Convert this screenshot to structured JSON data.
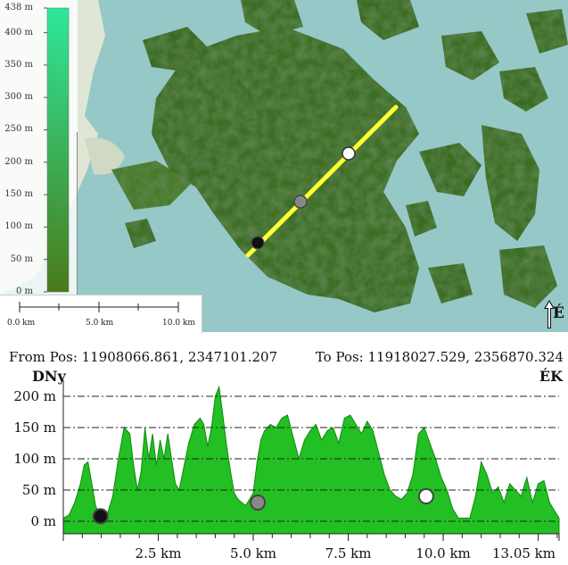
{
  "map": {
    "elevation_legend": {
      "labels": [
        "438 m",
        "400 m",
        "350 m",
        "300 m",
        "250 m",
        "200 m",
        "150 m",
        "100 m",
        "50 m",
        "0 m"
      ],
      "values": [
        438,
        400,
        350,
        300,
        250,
        200,
        150,
        100,
        50,
        0
      ],
      "max": 438,
      "colors": {
        "top": "#2ee89a",
        "bottom": "#4a7a1a"
      }
    },
    "scale_bar": {
      "labels": [
        "0.0 km",
        "5.0 km",
        "10.0 km"
      ]
    },
    "north_arrow": {
      "icon": "north-arrow-icon",
      "label": "É"
    },
    "colors": {
      "water": "#96c8c8",
      "terrain": "#3c6e28",
      "profile_line": "#ffff33"
    }
  },
  "profile": {
    "from_label": "From Pos: 11908066.861, 2347101.207",
    "to_label": "To Pos: 11918027.529, 2356870.324",
    "left_dir": "DNy",
    "right_dir": "ÉK",
    "colors": {
      "fill": "#22c022",
      "stroke": "#118811"
    },
    "chart_data": {
      "type": "area",
      "y_tick_labels": [
        "200 m",
        "150 m",
        "100 m",
        "50 m",
        "0 m"
      ],
      "y_ticks": [
        200,
        150,
        100,
        50,
        0
      ],
      "x_tick_labels": [
        "2.5 km",
        "5.0 km",
        "7.5 km",
        "10.0 km",
        "13.05 km"
      ],
      "x_ticks": [
        2.5,
        5.0,
        7.5,
        10.0,
        13.05
      ],
      "xlim": [
        0,
        13.05
      ],
      "ylim": [
        -20,
        220
      ],
      "grid": "horizontal dash-dot",
      "x": [
        0,
        0.15,
        0.3,
        0.45,
        0.55,
        0.65,
        0.75,
        0.85,
        0.95,
        1.05,
        1.15,
        1.3,
        1.45,
        1.6,
        1.75,
        1.85,
        1.95,
        2.05,
        2.15,
        2.25,
        2.35,
        2.45,
        2.55,
        2.65,
        2.75,
        2.85,
        2.95,
        3.05,
        3.15,
        3.3,
        3.45,
        3.6,
        3.7,
        3.8,
        3.9,
        4.0,
        4.1,
        4.2,
        4.3,
        4.4,
        4.5,
        4.6,
        4.7,
        4.8,
        4.9,
        5.0,
        5.1,
        5.2,
        5.3,
        5.45,
        5.6,
        5.75,
        5.9,
        6.05,
        6.2,
        6.35,
        6.5,
        6.65,
        6.8,
        6.95,
        7.1,
        7.25,
        7.4,
        7.55,
        7.7,
        7.85,
        8.0,
        8.15,
        8.3,
        8.45,
        8.6,
        8.75,
        8.9,
        9.05,
        9.2,
        9.35,
        9.5,
        9.65,
        9.8,
        9.95,
        10.1,
        10.25,
        10.4,
        10.55,
        10.7,
        10.85,
        11.0,
        11.15,
        11.3,
        11.45,
        11.6,
        11.75,
        11.9,
        12.05,
        12.2,
        12.35,
        12.5,
        12.65,
        12.8,
        12.95,
        13.05
      ],
      "y": [
        5,
        10,
        30,
        60,
        90,
        95,
        60,
        25,
        10,
        5,
        10,
        40,
        100,
        150,
        140,
        90,
        50,
        80,
        150,
        100,
        140,
        90,
        130,
        100,
        140,
        100,
        60,
        50,
        80,
        125,
        155,
        165,
        155,
        120,
        150,
        200,
        215,
        170,
        120,
        80,
        45,
        35,
        30,
        25,
        35,
        45,
        95,
        130,
        145,
        155,
        150,
        165,
        170,
        135,
        100,
        130,
        145,
        155,
        130,
        145,
        150,
        125,
        165,
        170,
        155,
        140,
        160,
        145,
        110,
        75,
        50,
        40,
        35,
        45,
        75,
        140,
        150,
        125,
        100,
        70,
        50,
        20,
        5,
        5,
        5,
        40,
        95,
        75,
        45,
        55,
        30,
        60,
        50,
        40,
        70,
        30,
        60,
        65,
        30,
        15,
        5
      ],
      "markers": [
        {
          "x": 0.98,
          "y": 8,
          "color": "#111111"
        },
        {
          "x": 5.12,
          "y": 30,
          "color": "#888888"
        },
        {
          "x": 9.55,
          "y": 40,
          "color": "#ffffff"
        }
      ]
    }
  }
}
